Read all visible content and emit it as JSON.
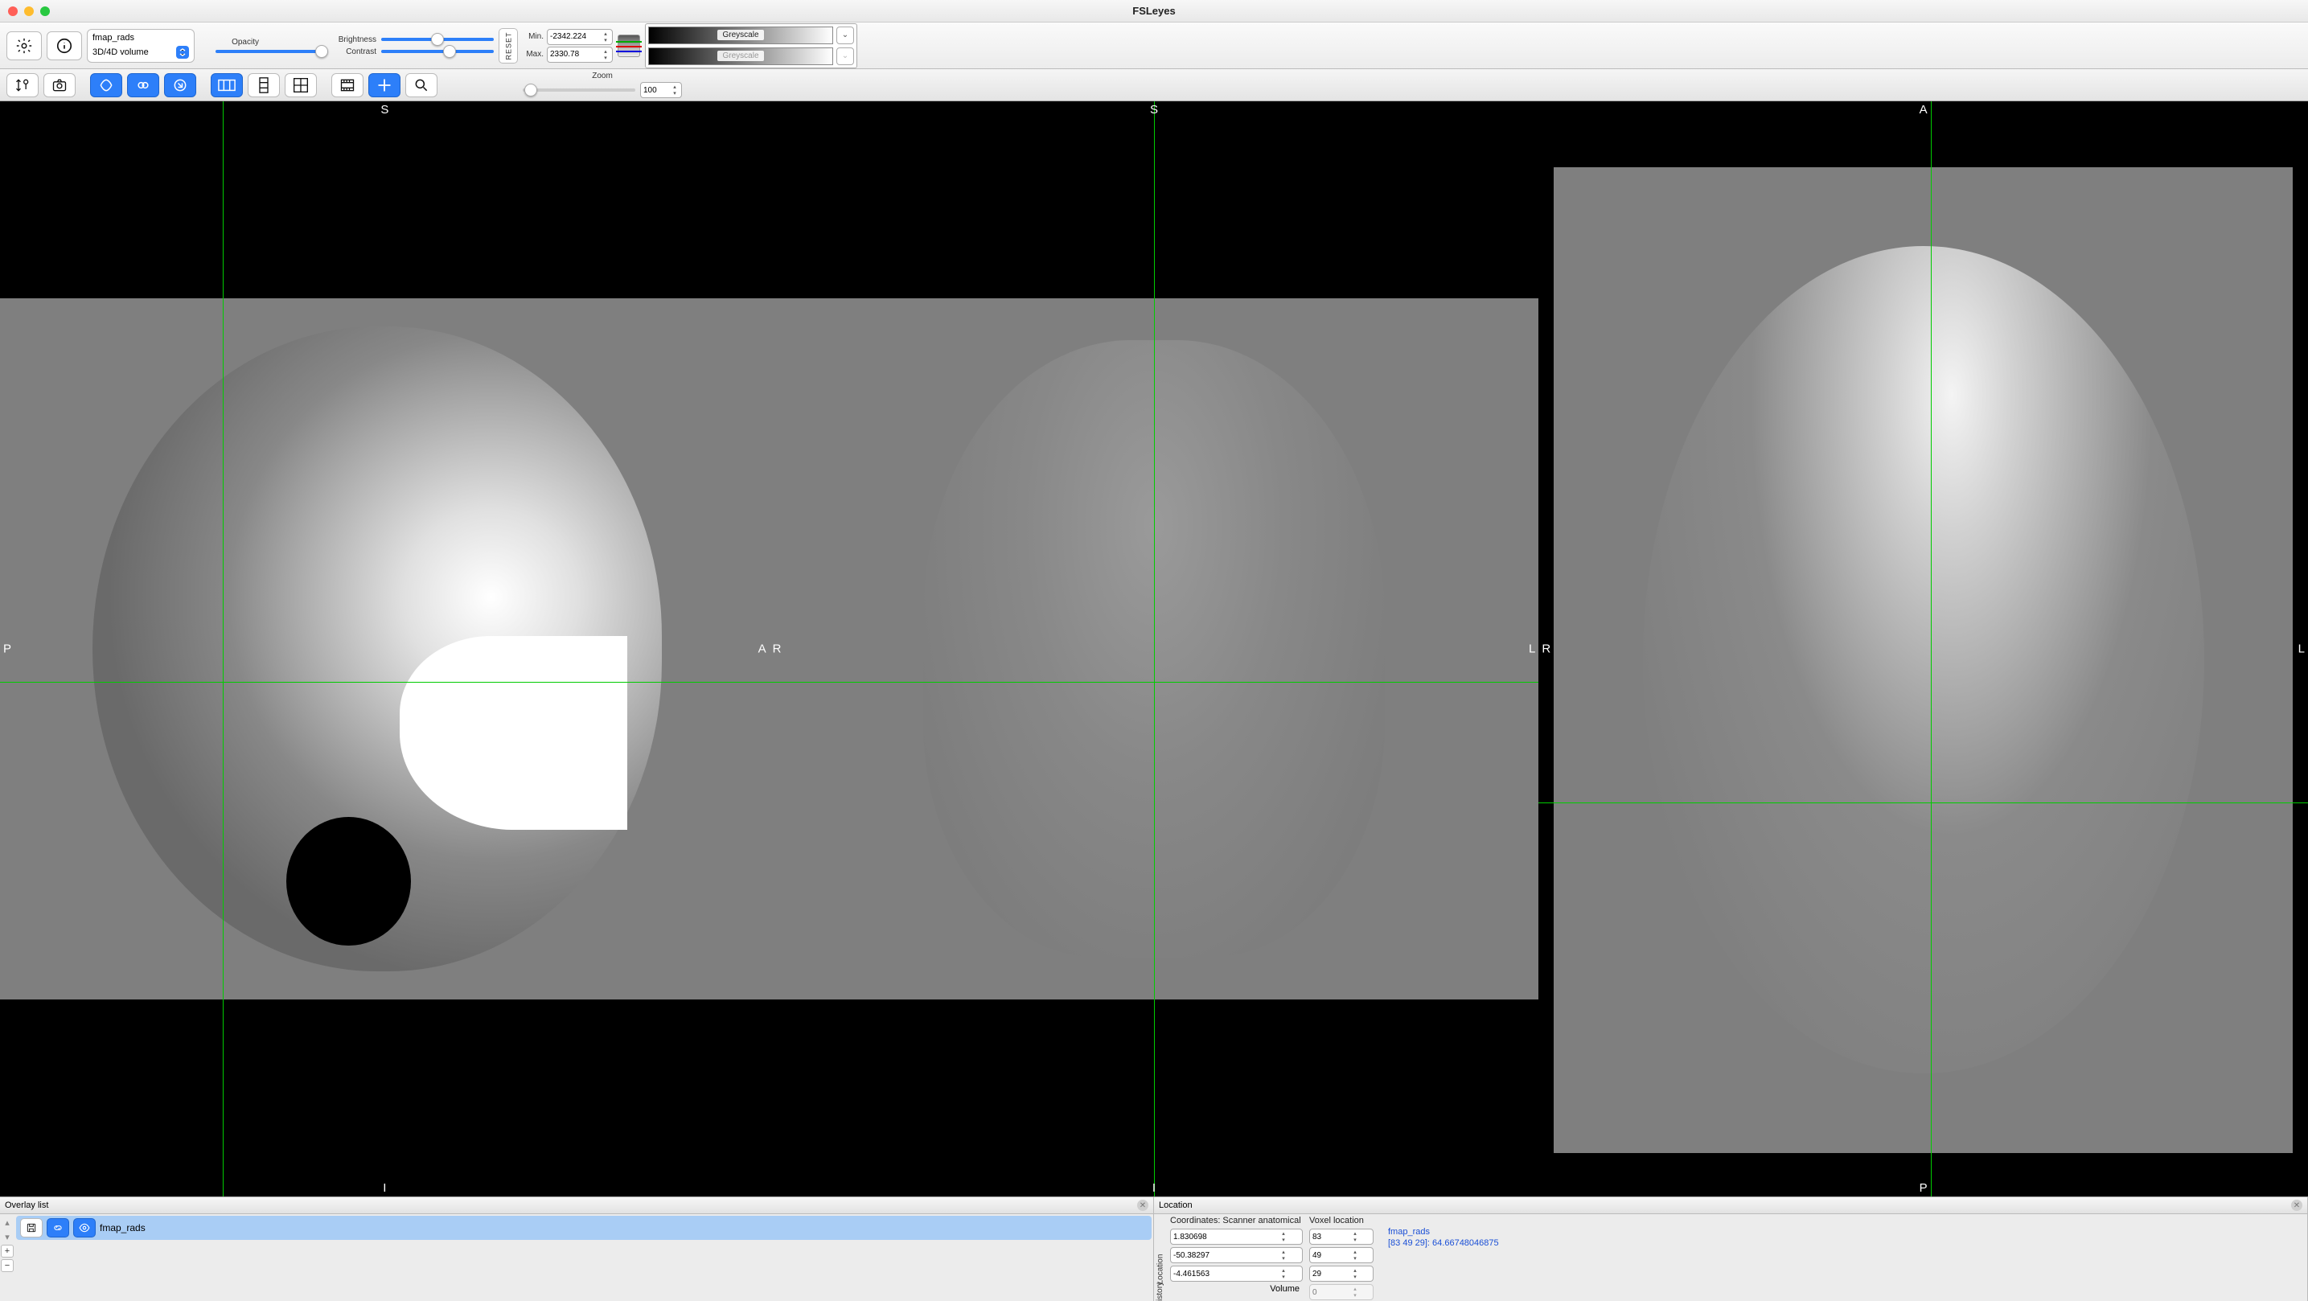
{
  "title": "FSLeyes",
  "overlay": {
    "name": "fmap_rads",
    "mode": "3D/4D volume"
  },
  "sliders": {
    "opacity": "Opacity",
    "brightness": "Brightness",
    "contrast": "Contrast"
  },
  "reset": "RESET",
  "range": {
    "min_label": "Min.",
    "max_label": "Max.",
    "min": "-2342.224",
    "max": "2330.78"
  },
  "cmap": {
    "primary": "Greyscale",
    "secondary": "Greyscale"
  },
  "zoom": {
    "label": "Zoom",
    "value": "100"
  },
  "orient": {
    "p1": {
      "top": "S",
      "bottom": "I",
      "left": "P",
      "right": "A"
    },
    "p2": {
      "top": "S",
      "bottom": "I",
      "left": "R",
      "right": "L"
    },
    "p3": {
      "top": "A",
      "bottom": "P",
      "left": "R",
      "right": "L"
    }
  },
  "overlay_list": {
    "title": "Overlay list",
    "item": "fmap_rads"
  },
  "location": {
    "title": "Location",
    "coord_label": "Coordinates: Scanner anatomical",
    "voxel_label": "Voxel location",
    "coords": {
      "x": "1.830698",
      "y": "-50.38297",
      "z": "-4.461563"
    },
    "voxel": {
      "x": "83",
      "y": "49",
      "z": "29"
    },
    "volume_label": "Volume",
    "volume": "0",
    "info_name": "fmap_rads",
    "info_val": "[83 49 29]: 64.66748046875",
    "tab_loc": "Location",
    "tab_hist": "History"
  }
}
